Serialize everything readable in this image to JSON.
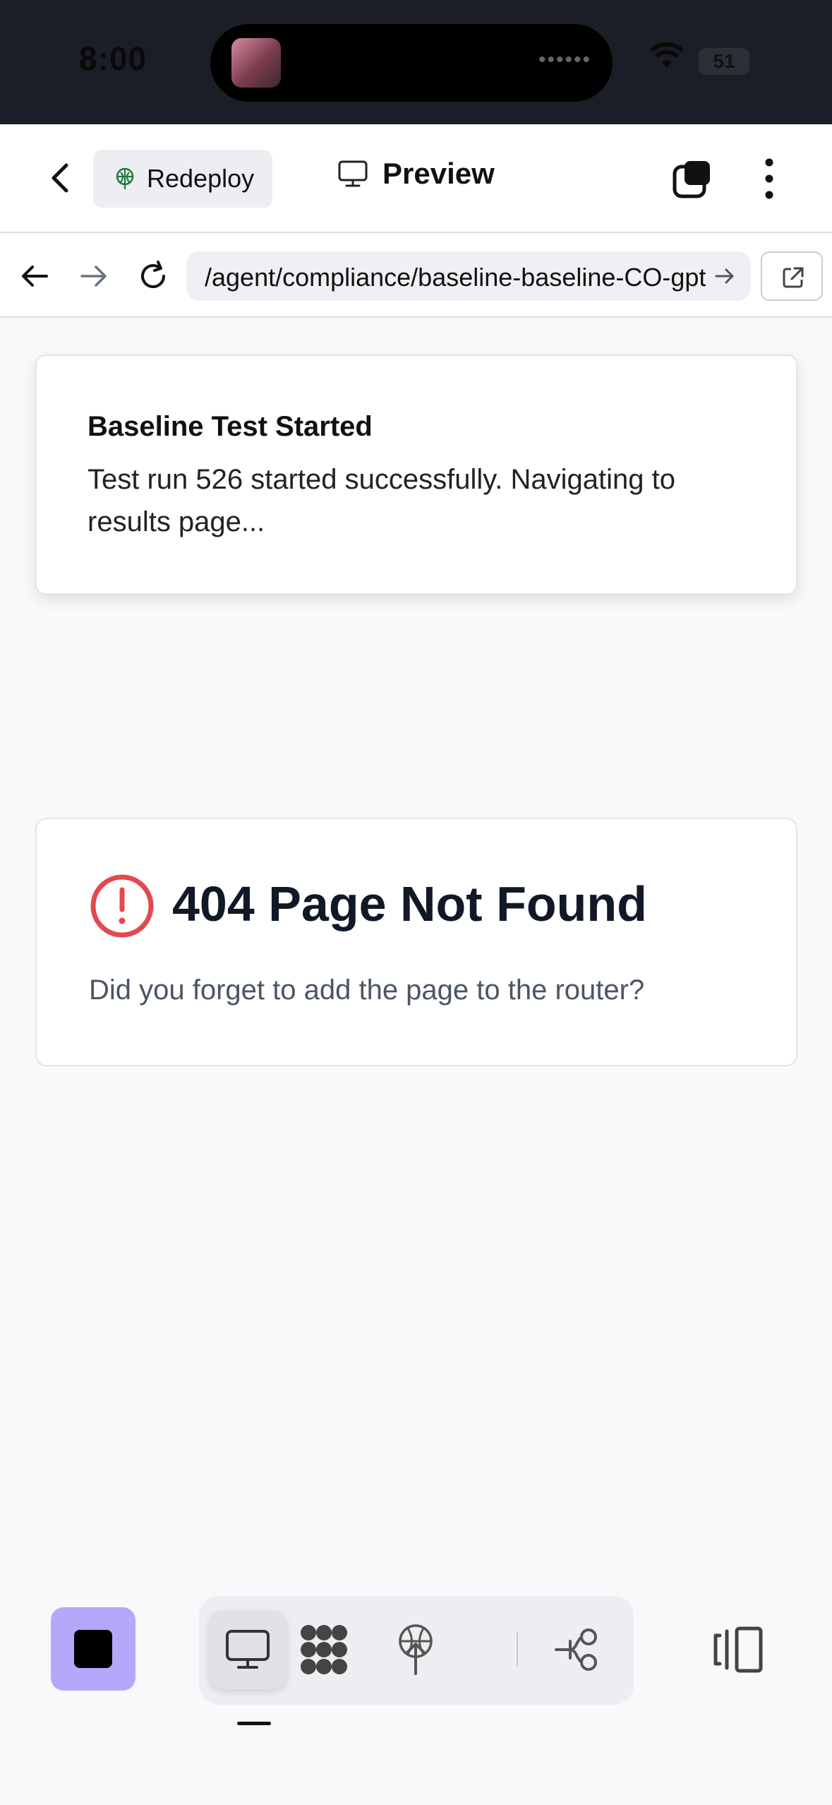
{
  "status_bar": {
    "time": "8:00",
    "battery": "51"
  },
  "header": {
    "redeploy_label": "Redeploy",
    "preview_label": "Preview"
  },
  "browser": {
    "url": "/agent/compliance/baseline-baseline-CO-gpt"
  },
  "toast": {
    "title": "Baseline Test Started",
    "message": "Test run 526 started successfully. Navigating to results page..."
  },
  "not_found": {
    "title": "404 Page Not Found",
    "subtitle": "Did you forget to add the page to the router?"
  },
  "colors": {
    "accent": "#b7a7fb",
    "error": "#e5484d",
    "redeploy_icon": "#1f7a3a"
  },
  "icons": [
    "back-icon",
    "globe-icon",
    "monitor-icon",
    "tabs-icon",
    "more-icon",
    "arrow-left-icon",
    "arrow-right-icon",
    "reload-icon",
    "external-link-icon",
    "alert-circle-icon",
    "stop-icon",
    "dots-grid-icon",
    "deploy-icon",
    "workflow-icon",
    "panel-icon"
  ]
}
